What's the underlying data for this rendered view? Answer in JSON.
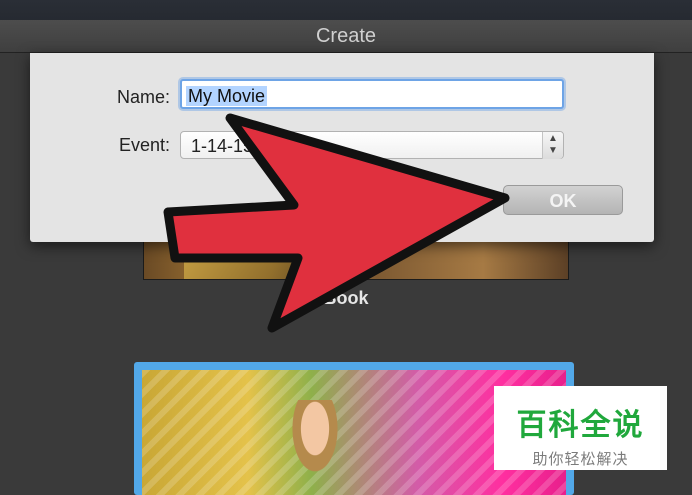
{
  "window": {
    "title": "Create"
  },
  "dialog": {
    "name_label": "Name:",
    "name_value": "My Movie",
    "event_label": "Event:",
    "event_value": "1-14-15",
    "ok_label": "OK"
  },
  "browser": {
    "thumbnail_label": "Book"
  },
  "overlay": {
    "arrow_color": "#e0303e",
    "watermark_title": "百科全说",
    "watermark_subtitle": "助你轻松解决"
  }
}
